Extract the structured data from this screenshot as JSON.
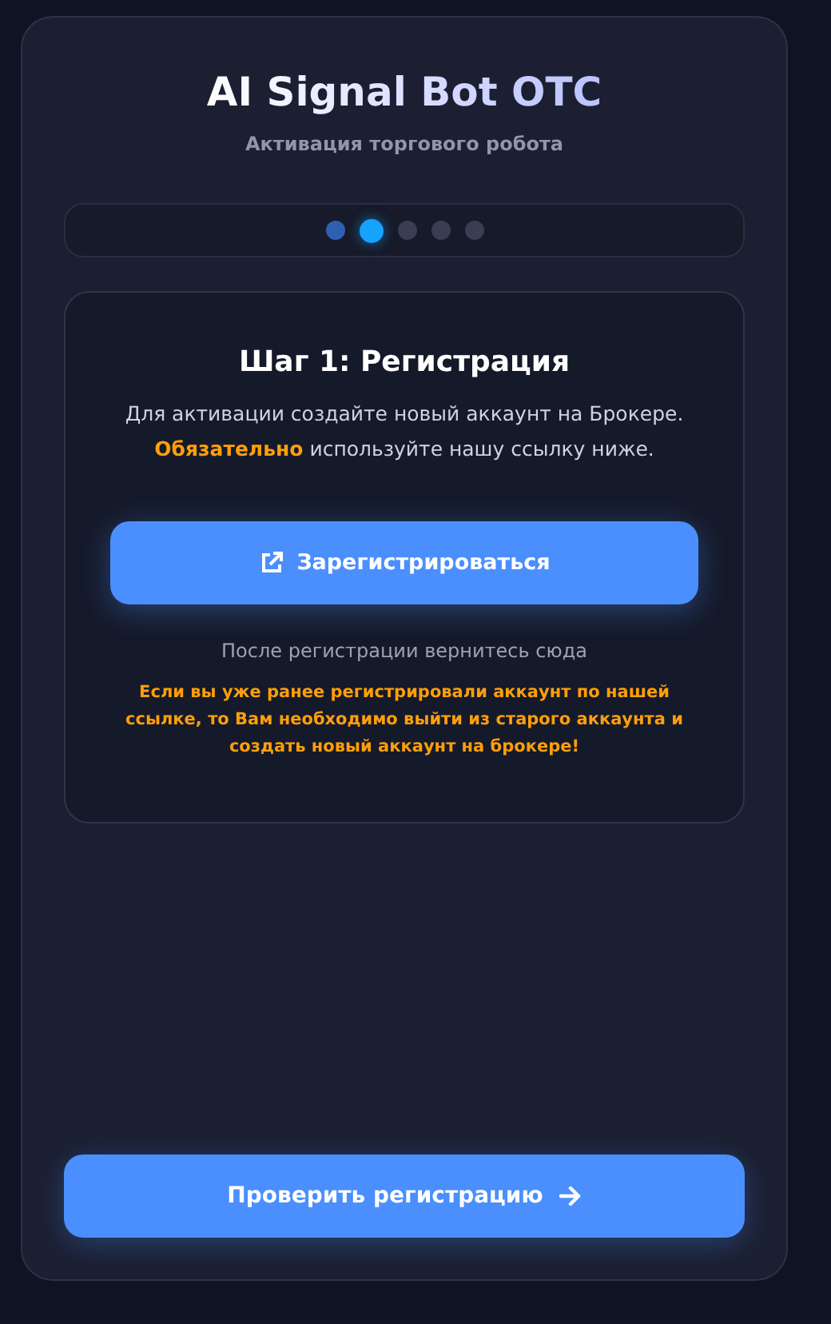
{
  "header": {
    "title": "AI Signal Bot OTC",
    "subtitle": "Активация торгового робота"
  },
  "steps": [
    {
      "completed": true,
      "selected": false
    },
    {
      "completed": false,
      "selected": true
    },
    {
      "completed": false,
      "selected": false
    },
    {
      "completed": false,
      "selected": false
    },
    {
      "completed": false,
      "selected": false
    }
  ],
  "step_card": {
    "title": "Шаг 1: Регистрация",
    "description": "Для активации создайте новый аккаунт на Брокере. **Обязательно** используйте нашу ссылку ниже.",
    "button": "Зарегистрироваться",
    "hint": "После регистрации вернитесь сюда",
    "warning": "Если вы уже ранее регистрировали аккаунт по нашей ссылке, то Вам необходимо выйти из старого аккаунта и создать новый аккаунт на брокере!"
  },
  "footer_button": "Проверить регистрацию"
}
